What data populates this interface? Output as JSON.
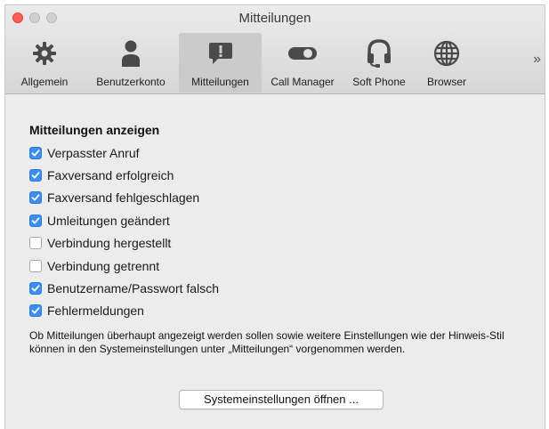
{
  "window": {
    "title": "Mitteilungen"
  },
  "toolbar": {
    "tabs": [
      {
        "label": "Allgemein",
        "icon": "gear-icon",
        "active": false
      },
      {
        "label": "Benutzerkonto",
        "icon": "user-icon",
        "active": false
      },
      {
        "label": "Mitteilungen",
        "icon": "notification-icon",
        "active": true
      },
      {
        "label": "Call Manager",
        "icon": "toggle-icon",
        "active": false
      },
      {
        "label": "Soft Phone",
        "icon": "headset-icon",
        "active": false
      },
      {
        "label": "Browser",
        "icon": "globe-icon",
        "active": false
      }
    ],
    "more_label": "»"
  },
  "main": {
    "heading": "Mitteilungen anzeigen",
    "options": [
      {
        "label": "Verpasster Anruf",
        "checked": true
      },
      {
        "label": "Faxversand erfolgreich",
        "checked": true
      },
      {
        "label": "Faxversand fehlgeschlagen",
        "checked": true
      },
      {
        "label": "Umleitungen geändert",
        "checked": true
      },
      {
        "label": "Verbindung hergestellt",
        "checked": false
      },
      {
        "label": "Verbindung getrennt",
        "checked": false
      },
      {
        "label": "Benutzername/Passwort falsch",
        "checked": true
      },
      {
        "label": "Fehlermeldungen",
        "checked": true
      }
    ],
    "info_text": "Ob Mitteilungen überhaupt angezeigt werden sollen sowie weitere Einstellungen wie der Hinweis-Stil können in den Systemeinstellungen unter „Mitteilungen“ vorgenommen werden.",
    "system_button_label": "Systemeinstellungen öffnen ..."
  },
  "colors": {
    "checkbox_checked": "#3b8ef7",
    "close_button": "#fc5f57",
    "active_tab": "#cbcbcb"
  }
}
